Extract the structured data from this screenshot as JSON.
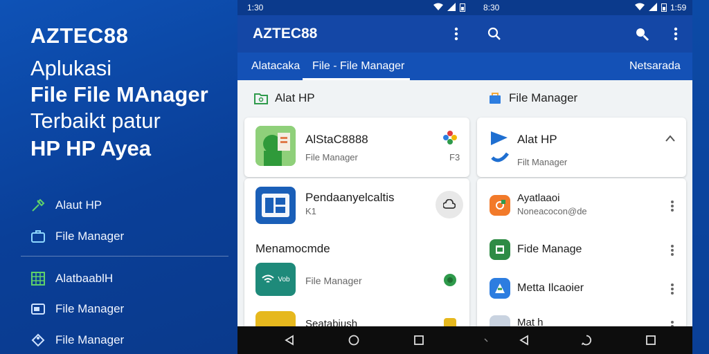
{
  "hero": {
    "brand": "AZTEC88",
    "line1": "Aplukasi",
    "line2": "File File MAnager",
    "line3": "Terbaikt patur",
    "line4": "HP HP Ayea"
  },
  "left_menu": [
    {
      "label": "Alaut HP",
      "icon": "tools-icon"
    },
    {
      "label": "File Manager",
      "icon": "briefcase-icon"
    },
    {
      "label": "AlatbaablH",
      "icon": "grid-icon"
    },
    {
      "label": "File Manager",
      "icon": "drive-icon"
    },
    {
      "label": "File Manager",
      "icon": "tag-icon"
    }
  ],
  "status": {
    "time_left": "1:30",
    "time_mid": "8:30",
    "time_right": "1:59"
  },
  "appbar": {
    "title": "AZTEC88"
  },
  "tabs": {
    "tab1": "Alatacaka",
    "tab2": "File - File Manager",
    "tab3": "Netsarada"
  },
  "left_col": {
    "section_title": "Alat HP",
    "card1": {
      "title": "AlStaC8888",
      "subtitle": "File Manager",
      "meta": "F3"
    },
    "card2": {
      "title": "Pendaanyelcaltis",
      "subtitle": "K1"
    },
    "subheading": "Menamocmde",
    "row3": {
      "tile_text": "Vob",
      "subtitle": "File Manager"
    },
    "row4": {
      "title": "Seatabiush"
    }
  },
  "right_col": {
    "section_title": "File Manager",
    "card1": {
      "title": "Alat HP",
      "subtitle": "Filt Manager"
    },
    "rows": [
      {
        "title": "Ayatlaaoi",
        "subtitle": "Noneacocon@de"
      },
      {
        "title": "Fide Manage",
        "subtitle": ""
      },
      {
        "title": "Metta Ilcaoier",
        "subtitle": ""
      },
      {
        "title": "Mat h",
        "subtitle": ""
      }
    ]
  },
  "colors": {
    "brand_blue": "#1447a6",
    "dark_blue": "#0b3a8c",
    "green": "#2e9a4b",
    "teal": "#1e8a7a"
  }
}
